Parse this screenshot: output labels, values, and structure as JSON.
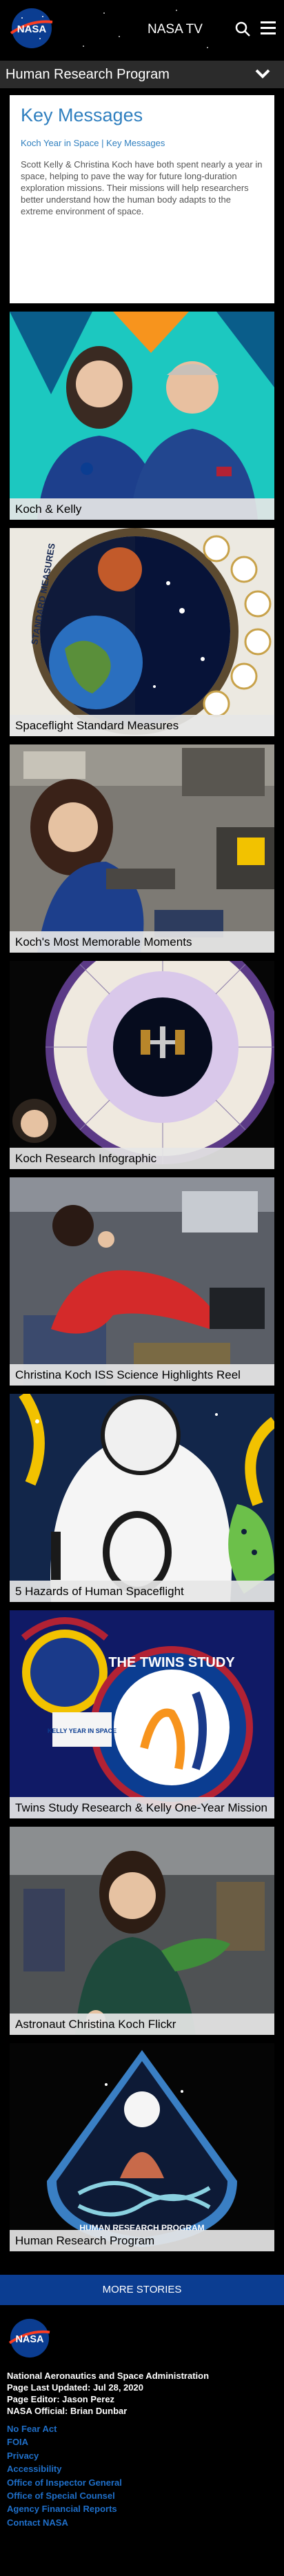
{
  "header": {
    "logo_text": "NASA",
    "nasa_tv": "NASA TV"
  },
  "section": {
    "title": "Human Research Program"
  },
  "key_messages": {
    "title": "Key Messages",
    "breadcrumb": "Koch Year in Space | Key Messages",
    "body": "Scott Kelly & Christina Koch have both spent nearly a year in space, helping to pave the way for future long-duration exploration missions.  Their missions will help researchers better understand how the human body adapts to the extreme environment of space."
  },
  "tiles": [
    {
      "caption": "Koch & Kelly"
    },
    {
      "caption": "Spaceflight Standard Measures"
    },
    {
      "caption": "Koch's Most Memorable Moments"
    },
    {
      "caption": "Koch Research Infographic"
    },
    {
      "caption": "Christina Koch ISS Science Highlights Reel"
    },
    {
      "caption": "5 Hazards of Human Spaceflight"
    },
    {
      "caption": "Twins Study Research & Kelly One-Year Mission"
    },
    {
      "caption": "Astronaut Christina Koch Flickr"
    },
    {
      "caption": "Human Research Program"
    }
  ],
  "art_text": {
    "standard_measures": "STANDARD MEASURES",
    "twins_study": "THE TWINS STUDY",
    "kelly_year": "KELLY YEAR IN SPACE",
    "hrp_patch": "HUMAN RESEARCH PROGRAM"
  },
  "more_stories": "MORE STORIES",
  "footer": {
    "agency": "National Aeronautics and Space Administration",
    "last_updated": "Page Last Updated: Jul 28, 2020",
    "editor": "Page Editor: Jason Perez",
    "official": "NASA Official: Brian Dunbar",
    "links": [
      "No Fear Act",
      "FOIA",
      "Privacy",
      "Accessibility",
      "Office of Inspector General",
      "Office of Special Counsel",
      "Agency Financial Reports",
      "Contact NASA"
    ]
  },
  "colors": {
    "accent_blue": "#2f7fbf",
    "link_blue": "#1f6fc9",
    "more_bar": "#0b3d91",
    "section_bar": "#2b2b2b"
  }
}
